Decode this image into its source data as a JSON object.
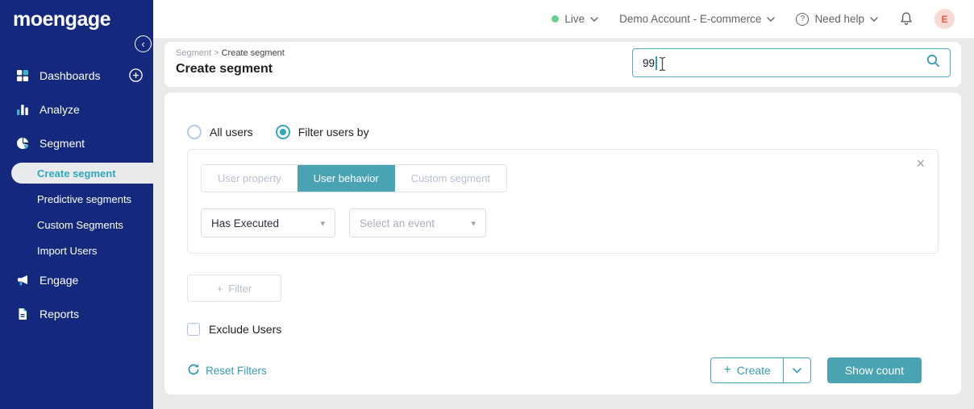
{
  "brand": {
    "logo_text": "moengage"
  },
  "topbar": {
    "environment": {
      "label": "Live",
      "status_color": "#67D095"
    },
    "account_selector": "Demo Account - E-commerce",
    "help": {
      "icon_glyph": "?",
      "label": "Need help"
    },
    "avatar": {
      "initial": "E",
      "bg": "#FAD9D4",
      "color": "#DF5A4E"
    }
  },
  "sidebar": {
    "items": [
      {
        "label": "Dashboards",
        "icon": "grid-icon"
      },
      {
        "label": "Analyze",
        "icon": "bar-chart-icon"
      },
      {
        "label": "Segment",
        "icon": "pie-chart-icon"
      },
      {
        "label": "Engage",
        "icon": "megaphone-icon"
      },
      {
        "label": "Reports",
        "icon": "document-icon"
      }
    ],
    "segment_submenu": [
      {
        "label": "Create segment",
        "active": true
      },
      {
        "label": "Predictive segments",
        "active": false
      },
      {
        "label": "Custom Segments",
        "active": false
      },
      {
        "label": "Import Users",
        "active": false
      }
    ]
  },
  "header": {
    "breadcrumb": {
      "parent": "Segment",
      "separator": ">",
      "current": "Create segment"
    },
    "title": "Create segment",
    "search": {
      "value": "99"
    }
  },
  "segment_builder": {
    "user_scope_options": [
      {
        "label": "All users",
        "selected": false
      },
      {
        "label": "Filter users by",
        "selected": true
      }
    ],
    "filter_tabs": [
      {
        "label": "User property",
        "active": false
      },
      {
        "label": "User behavior",
        "active": true
      },
      {
        "label": "Custom segment",
        "active": false
      }
    ],
    "condition": {
      "operator_value": "Has Executed",
      "event_placeholder": "Select an event"
    },
    "add_filter_label": "Filter",
    "exclude_users_label": "Exclude Users",
    "exclude_users_checked": false,
    "reset_filters_label": "Reset Filters",
    "create_label": "Create",
    "show_count_label": "Show count"
  },
  "icons": {
    "plus": "+",
    "close": "×",
    "dropdown_arrow": "▾",
    "chevron_left": "‹"
  },
  "colors": {
    "sidebar_navy": "#14297E",
    "accent_teal": "#4AA3B2",
    "active_link_teal": "#2FA8BD",
    "page_bg": "#E9EAEB",
    "live_green": "#67D095"
  }
}
